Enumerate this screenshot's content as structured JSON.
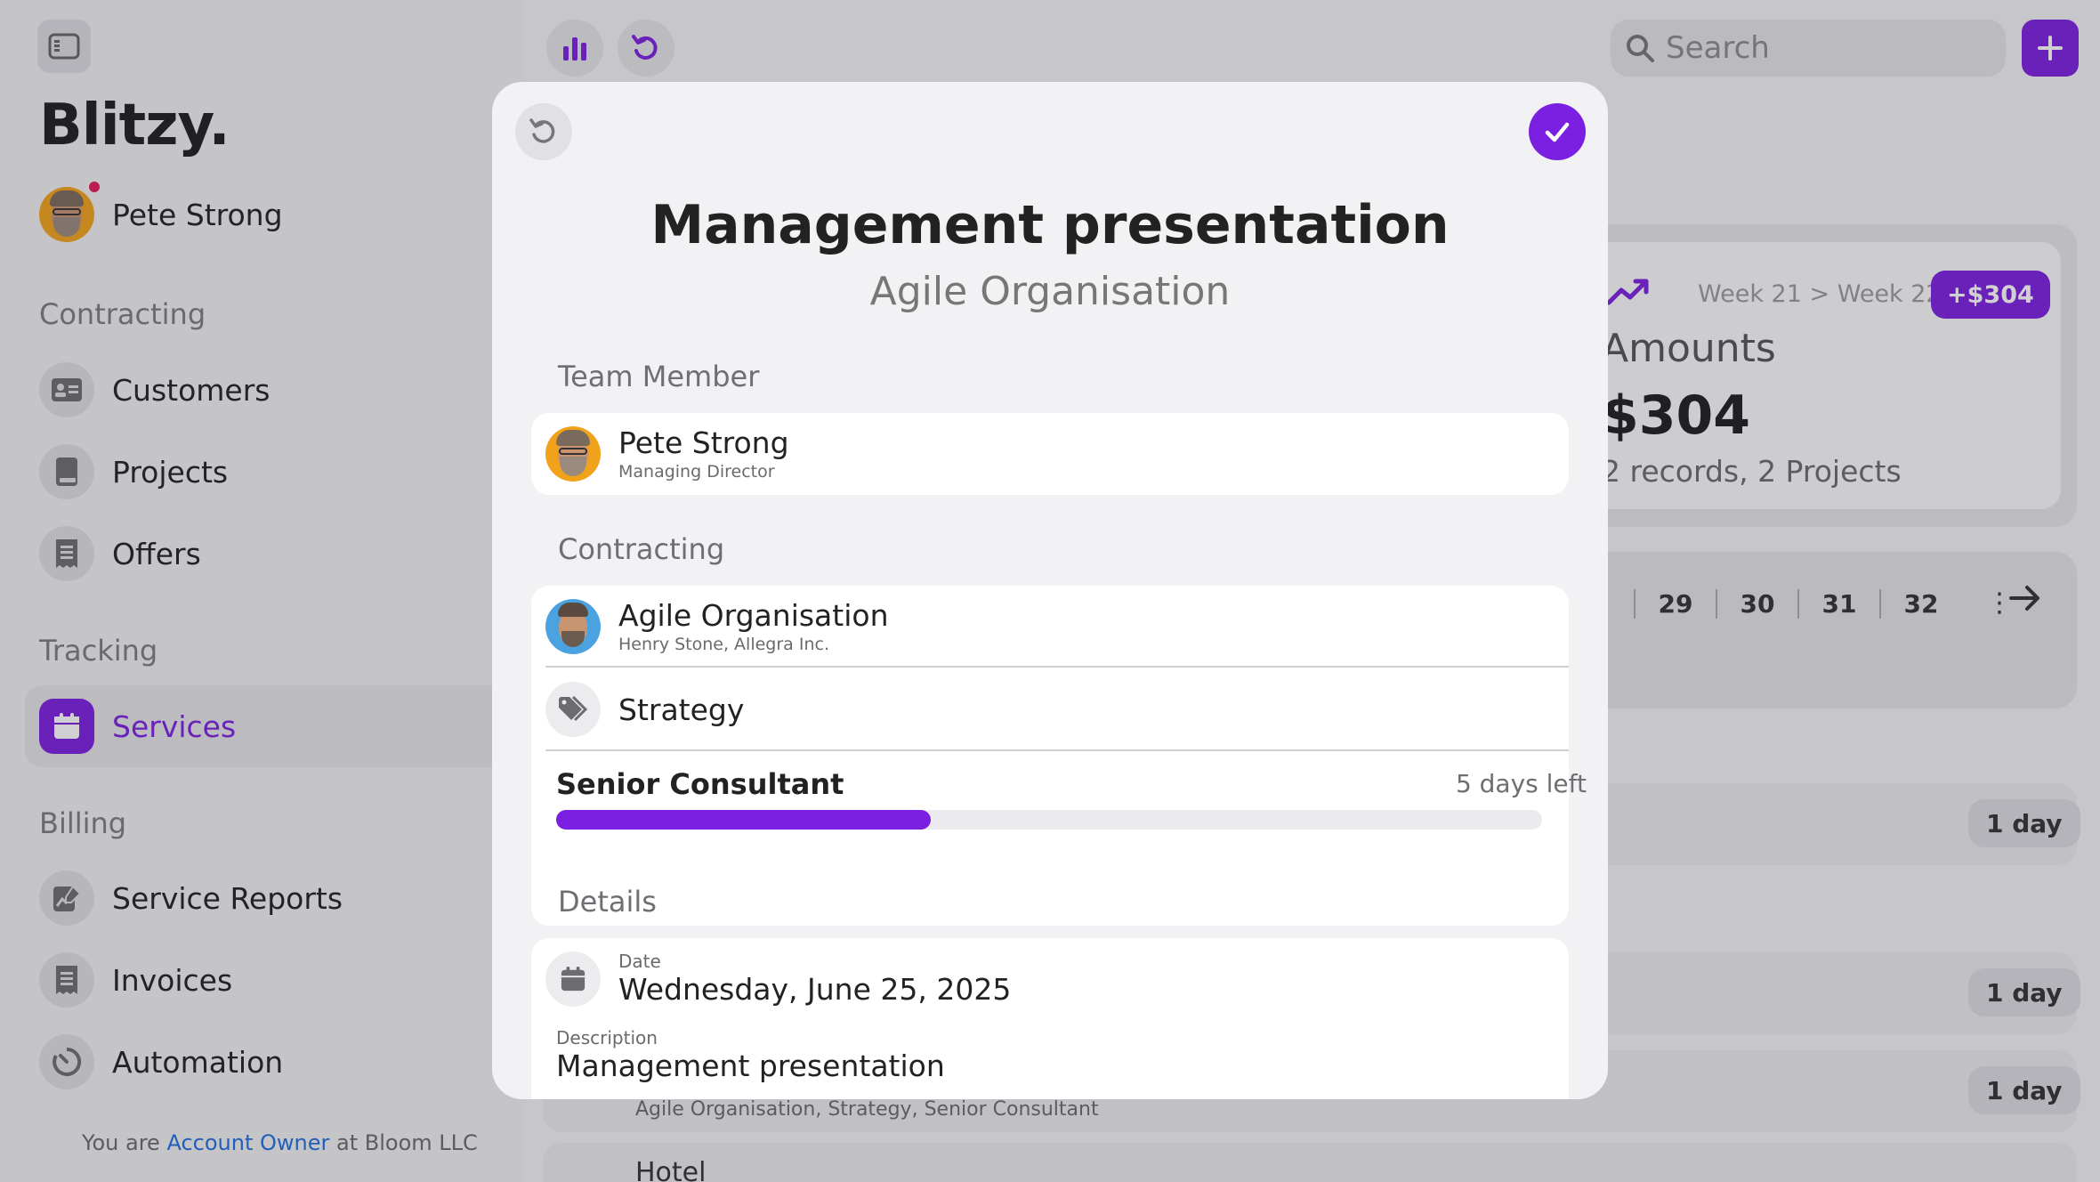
{
  "app": {
    "brand": "Blitzy."
  },
  "user": {
    "name": "Pete Strong"
  },
  "sidebar": {
    "sections": [
      {
        "label": "Contracting",
        "items": [
          {
            "label": "Customers",
            "icon": "contact-card-icon"
          },
          {
            "label": "Projects",
            "icon": "book-icon"
          },
          {
            "label": "Offers",
            "icon": "receipt-icon"
          }
        ]
      },
      {
        "label": "Tracking",
        "items": [
          {
            "label": "Services",
            "icon": "calendar-icon",
            "active": true
          }
        ]
      },
      {
        "label": "Billing",
        "items": [
          {
            "label": "Service Reports",
            "icon": "report-icon"
          },
          {
            "label": "Invoices",
            "icon": "receipt-icon"
          },
          {
            "label": "Automation",
            "icon": "timer-icon"
          }
        ]
      }
    ],
    "footer": {
      "prefix": "You are",
      "role": "Account Owner",
      "suffix": "at Bloom LLC"
    }
  },
  "topbar": {
    "search_placeholder": "Search"
  },
  "stats": {
    "week_range": "Week 21 > Week 22",
    "delta": "+$304",
    "label": "Amounts",
    "amount": "$304",
    "sub": "2 records, 2 Projects"
  },
  "weeks": {
    "items": [
      "29",
      "30",
      "31",
      "32"
    ]
  },
  "rows": {
    "pill": "1 day",
    "meta": "Agile Organisation, Strategy, Senior Consultant",
    "title": "Hotel"
  },
  "modal": {
    "title": "Management presentation",
    "subtitle": "Agile Organisation",
    "team_section": "Team Member",
    "member": {
      "name": "Pete Strong",
      "role": "Managing Director"
    },
    "contracting_section": "Contracting",
    "customer": {
      "name": "Agile Organisation",
      "contact": "Henry Stone, Allegra Inc."
    },
    "project": "Strategy",
    "position": {
      "role": "Senior Consultant",
      "remaining": "5 days left",
      "progress_fraction": 0.38
    },
    "details_section": "Details",
    "date": {
      "label": "Date",
      "value": "Wednesday, June 25, 2025"
    },
    "description": {
      "label": "Description",
      "value": "Management presentation"
    }
  },
  "colors": {
    "accent": "#7b1fe0",
    "link": "#1f6fe0",
    "notification": "#e6195a"
  }
}
